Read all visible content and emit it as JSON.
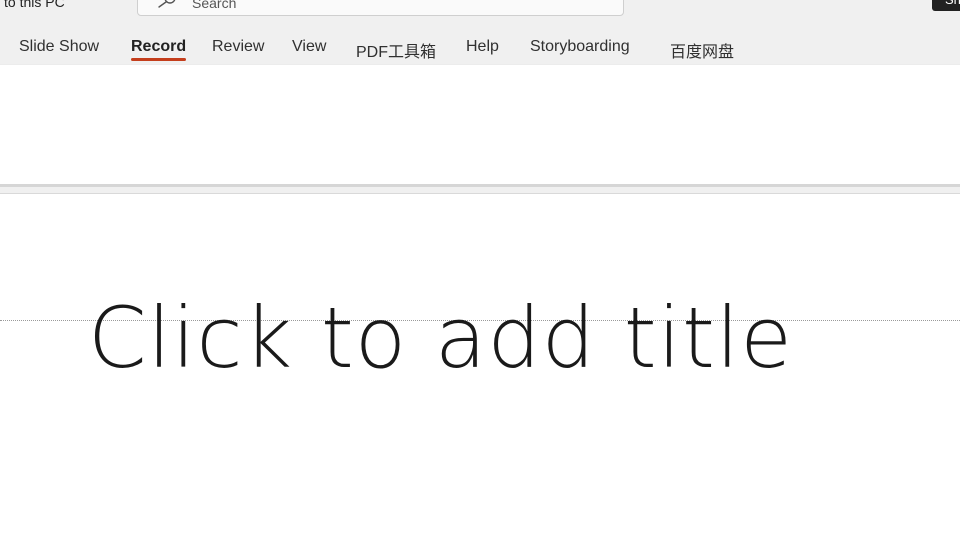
{
  "titlebar": {
    "save_location": "to this PC",
    "share_label": "Sh"
  },
  "search": {
    "placeholder": "Search",
    "value": ""
  },
  "ribbon": {
    "active_tab": "Record",
    "tabs": [
      {
        "label": "Slide Show"
      },
      {
        "label": "Record"
      },
      {
        "label": "Review"
      },
      {
        "label": "View"
      },
      {
        "label": "PDF工具箱"
      },
      {
        "label": "Help"
      },
      {
        "label": "Storyboarding"
      },
      {
        "label": "百度网盘"
      }
    ]
  },
  "slide": {
    "title_placeholder": "Click to add title"
  },
  "colors": {
    "active_tab_underline": "#c43e1c",
    "chrome_background": "#f0f0f0",
    "share_button": "#222222"
  },
  "icons": {
    "search": "search-icon"
  }
}
